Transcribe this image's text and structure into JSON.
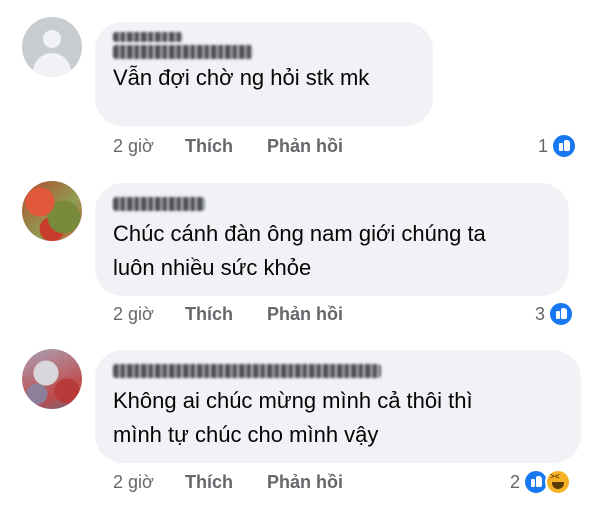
{
  "comments": [
    {
      "text_lines": [
        "Vẫn đợi chờ ng hỏi stk mk"
      ],
      "time": "2 giờ",
      "like_label": "Thích",
      "reply_label": "Phản hồi",
      "reaction_count": "1",
      "reactions": [
        "like-icon"
      ]
    },
    {
      "text_lines": [
        "Chúc cánh đàn ông nam giới chúng ta",
        "luôn nhiều sức khỏe"
      ],
      "time": "2 giờ",
      "like_label": "Thích",
      "reply_label": "Phản hồi",
      "reaction_count": "3",
      "reactions": [
        "like-icon"
      ]
    },
    {
      "text_lines": [
        "Không ai chúc mừng mình cả thôi thì",
        "mình tự chúc cho mình vậy"
      ],
      "time": "2 giờ",
      "like_label": "Thích",
      "reply_label": "Phản hồi",
      "reaction_count": "2",
      "reactions": [
        "like-icon",
        "haha-icon"
      ]
    }
  ],
  "colors": {
    "bubble": "#f0f2f5",
    "action_text": "#65676b",
    "like_blue": "#1877f2",
    "haha_yellow": "#f7b125"
  }
}
